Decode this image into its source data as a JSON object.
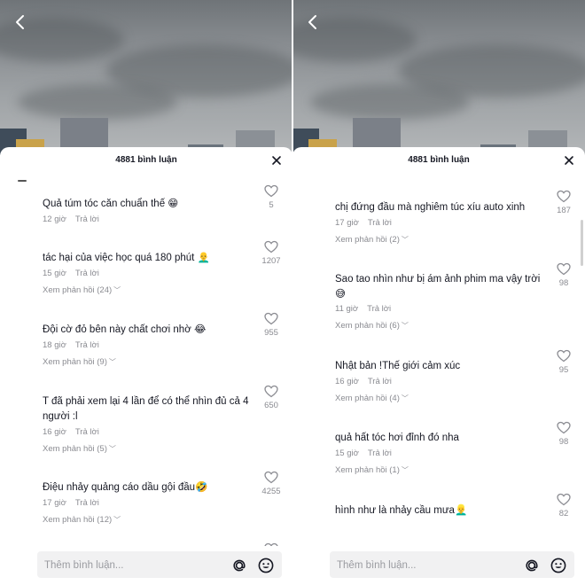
{
  "left": {
    "title": "4881 bình luận",
    "comments": [
      {
        "text": "Quả túm tóc căn chuẩn thế 😁",
        "time": "12 giờ",
        "reply": "Trả lời",
        "replies": "",
        "likes": "5"
      },
      {
        "text": "tác hại của việc học quá 180 phút 👨‍🦲",
        "time": "15 giờ",
        "reply": "Trả lời",
        "replies": "Xem phản hồi (24)",
        "likes": "1207"
      },
      {
        "text": "Đội cờ đỏ bên này chất chơi nhờ 😂",
        "time": "18 giờ",
        "reply": "Trả lời",
        "replies": "Xem phản hồi (9)",
        "likes": "955"
      },
      {
        "text": "T đã phải xem lại 4 lần để có thể nhìn đủ cả 4 người :l",
        "time": "16 giờ",
        "reply": "Trả lời",
        "replies": "Xem phản hồi (5)",
        "likes": "650"
      },
      {
        "text": "Điệu nhảy quảng cáo dầu gội đầu🤣",
        "time": "17 giờ",
        "reply": "Trả lời",
        "replies": "Xem phản hồi (12)",
        "likes": "4255"
      }
    ],
    "input_placeholder": "Thêm bình luận..."
  },
  "right": {
    "title": "4881 bình luận",
    "comments": [
      {
        "text": "chị đứng đầu mà nghiêm túc xíu auto xinh",
        "time": "17 giờ",
        "reply": "Trả lời",
        "replies": "Xem phản hồi (2)",
        "likes": "187"
      },
      {
        "text": "Sao tao nhìn như bị ám ảnh phim ma vậy trời 😅",
        "time": "11 giờ",
        "reply": "Trả lời",
        "replies": "Xem phản hồi (6)",
        "likes": "98"
      },
      {
        "text": "Nhật bản !Thế giới cảm xúc",
        "time": "16 giờ",
        "reply": "Trả lời",
        "replies": "Xem phản hồi (4)",
        "likes": "95"
      },
      {
        "text": "quả hất tóc hơi đỉnh đó nha",
        "time": "15 giờ",
        "reply": "Trả lời",
        "replies": "Xem phản hồi (1)",
        "likes": "98"
      },
      {
        "text": "hình như là nhảy cầu mưa👱‍♂️",
        "time": "",
        "reply": "",
        "replies": "",
        "likes": "82"
      }
    ],
    "input_placeholder": "Thêm bình luận..."
  },
  "icons": {
    "back": "chevron-left-icon",
    "close": "close-icon",
    "like": "heart-outline-icon",
    "mention": "at-icon",
    "emoji": "smiley-icon"
  },
  "colors": {
    "text": "#161823",
    "muted": "#8a8b91",
    "input_bg": "#f1f1f2"
  }
}
